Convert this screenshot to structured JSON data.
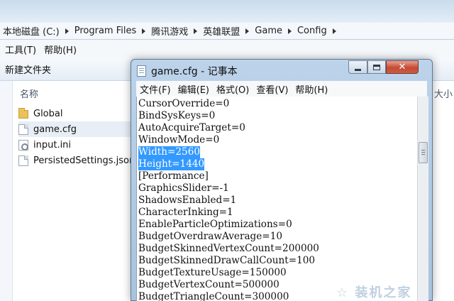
{
  "explorer": {
    "breadcrumb": [
      "本地磁盘 (C:)",
      "Program Files",
      "腾讯游戏",
      "英雄联盟",
      "Game",
      "Config"
    ],
    "menu": [
      "工具(T)",
      "帮助(H)"
    ],
    "toolbar": {
      "new_folder": "新建文件夹"
    },
    "columns": {
      "name": "名称",
      "size": "大小"
    },
    "files": [
      {
        "name": "Global",
        "icon": "folder-icon"
      },
      {
        "name": "game.cfg",
        "icon": "document-icon"
      },
      {
        "name": "input.ini",
        "icon": "settings-file-icon"
      },
      {
        "name": "PersistedSettings.json",
        "icon": "document-icon"
      }
    ]
  },
  "notepad": {
    "title": "game.cfg - 记事本",
    "close_glyph": "✕",
    "menu": [
      "文件(F)",
      "编辑(E)",
      "格式(O)",
      "查看(V)",
      "帮助(H)"
    ],
    "lines": [
      "CursorOverride=0",
      "BindSysKeys=0",
      "AutoAcquireTarget=0",
      "WindowMode=0",
      "Width=2560",
      "Height=1440",
      "[Performance]",
      "GraphicsSlider=-1",
      "ShadowsEnabled=1",
      "CharacterInking=1",
      "EnableParticleOptimizations=0",
      "BudgetOverdrawAverage=10",
      "BudgetSkinnedVertexCount=200000",
      "BudgetSkinnedDrawCallCount=100",
      "BudgetTextureUsage=150000",
      "BudgetVertexCount=500000",
      "BudgetTriangleCount=300000"
    ],
    "selected_lines": [
      "Width=2560",
      "Height=1440"
    ]
  },
  "watermark": "☆ 装机之家"
}
